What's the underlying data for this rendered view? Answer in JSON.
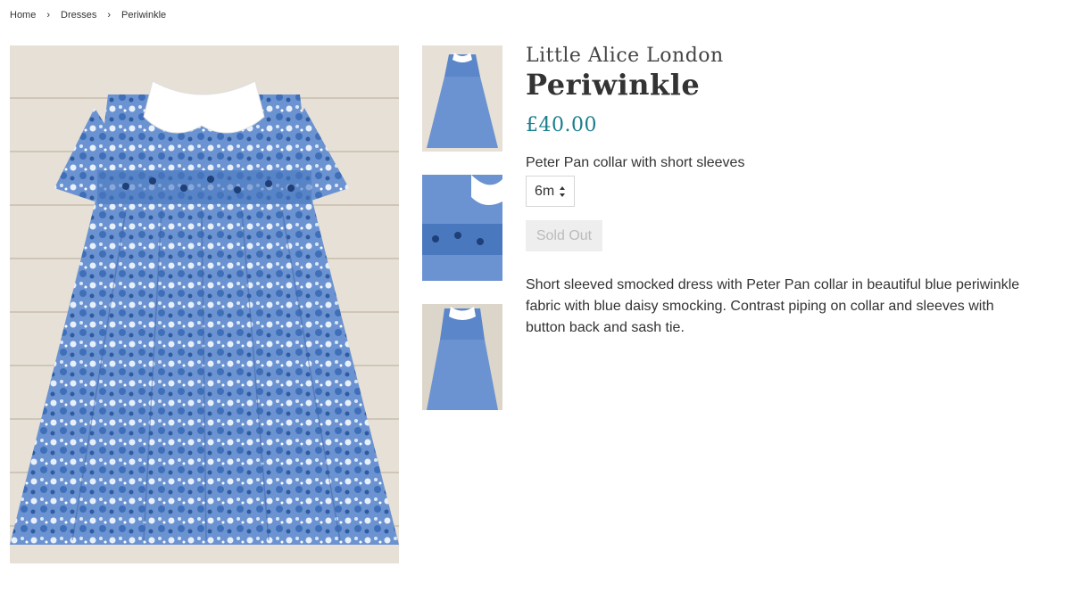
{
  "breadcrumb": {
    "items": [
      "Home",
      "Dresses",
      "Periwinkle"
    ],
    "separator": "›"
  },
  "product": {
    "vendor": "Little Alice London",
    "title": "Periwinkle",
    "price": "£40.00",
    "variant_label": "Peter Pan collar with short sleeves",
    "size_selected": "6m",
    "button_label": "Sold Out",
    "description": "Short sleeved smocked dress with Peter Pan collar in beautiful blue periwinkle fabric with blue daisy smocking.  Contrast piping on collar and sleeves with button back and sash tie."
  },
  "gallery": {
    "main_image": "blue floral smocked dress with white peter pan collar on wooden floor",
    "thumbnails": [
      "dress front view",
      "smocking detail",
      "dress full view"
    ]
  },
  "colors": {
    "price": "#1a7e8c",
    "dress_blue": "#5b86c9",
    "floor": "#e9e4dc",
    "button_bg": "#eeeeee",
    "button_text": "#bbbbbb"
  }
}
